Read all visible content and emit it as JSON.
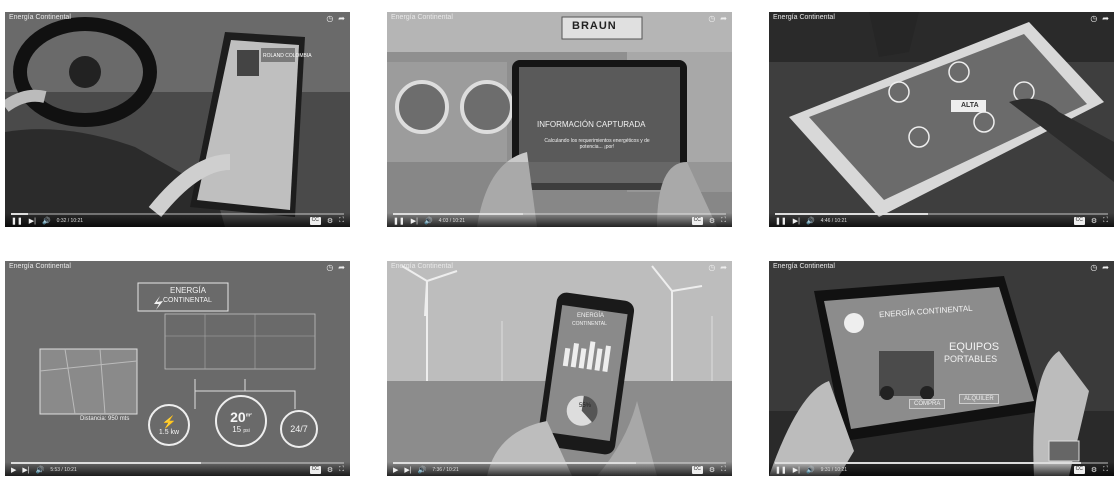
{
  "videos": [
    {
      "channel_title": "Energía Continental",
      "time": "0:32 / 10:21",
      "progress": 0.05,
      "scene": "car-tablet",
      "screen_texts": [
        "ROLAND COLOMBIA"
      ]
    },
    {
      "channel_title": "Energía Continental",
      "time": "4:03 / 10:21",
      "progress": 0.39,
      "scene": "factory-tablet",
      "screen_texts": [
        "BRAUN",
        "INFORMACIÓN CAPTURADA",
        "Calculando los requerimientos energéticos y de potencia... ¡por!"
      ]
    },
    {
      "channel_title": "Energía Continental",
      "time": "4:46 / 10:21",
      "progress": 0.46,
      "scene": "table-screen",
      "screen_texts": [
        "ALTA"
      ]
    },
    {
      "channel_title": "Energía Continental",
      "time": "5:53 / 10:21",
      "progress": 0.57,
      "scene": "map-stats",
      "screen_texts": [
        "ENERGÍA",
        "CONTINENTAL",
        "Distancia: 950 mts",
        "1.5 kw",
        "20",
        "m²",
        "15",
        "psi",
        "24/7"
      ]
    },
    {
      "channel_title": "Energía Continental",
      "time": "7:36 / 10:21",
      "progress": 0.73,
      "scene": "wind-phone",
      "screen_texts": [
        "ENERGÍA",
        "CONTINENTAL",
        "55%"
      ]
    },
    {
      "channel_title": "Energía Continental",
      "time": "9:31 / 10:21",
      "progress": 0.92,
      "scene": "tablet-portables",
      "screen_texts": [
        "ENERGÍA CONTINENTAL",
        "EQUIPOS",
        "PORTABLES",
        "COMPRA",
        "ALQUILER"
      ]
    }
  ],
  "icons": {
    "clock": "clock-icon",
    "share": "share-icon",
    "play": "play-icon",
    "pause": "pause-icon",
    "next": "next-icon",
    "volume": "volume-icon",
    "captions": "captions-icon",
    "settings": "settings-icon",
    "fullscreen": "fullscreen-icon"
  }
}
